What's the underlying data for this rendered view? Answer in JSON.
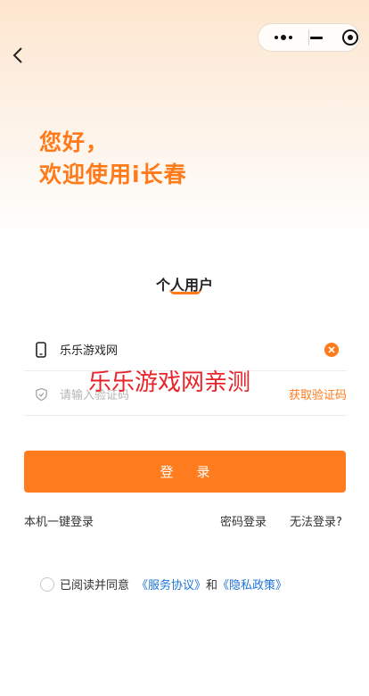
{
  "capsule": {
    "more_icon": "more-dots-icon",
    "minimize_icon": "minus-icon",
    "close_icon": "target-circle-icon"
  },
  "header": {
    "back_icon": "chevron-left-icon"
  },
  "greeting": {
    "line1": "您好，",
    "line2": "欢迎使用i长春"
  },
  "tab": {
    "label": "个人用户"
  },
  "form": {
    "phone_value": "乐乐游戏网",
    "phone_icon": "phone-icon",
    "clear_icon": "clear-icon",
    "code_placeholder": "请输入验证码",
    "code_icon": "shield-icon",
    "get_code_label": "获取验证码"
  },
  "watermark": {
    "text": "乐乐游戏网亲测"
  },
  "login_button": {
    "label": "登录"
  },
  "links": {
    "one_click": "本机一键登录",
    "password": "密码登录",
    "cant_login": "无法登录?"
  },
  "agreement": {
    "prefix": "已阅读并同意",
    "service": "《服务协议》",
    "and": "和",
    "privacy": "《隐私政策》"
  },
  "colors": {
    "accent": "#ff7a1a",
    "link": "#1e74d8",
    "watermark": "#e8242a"
  }
}
